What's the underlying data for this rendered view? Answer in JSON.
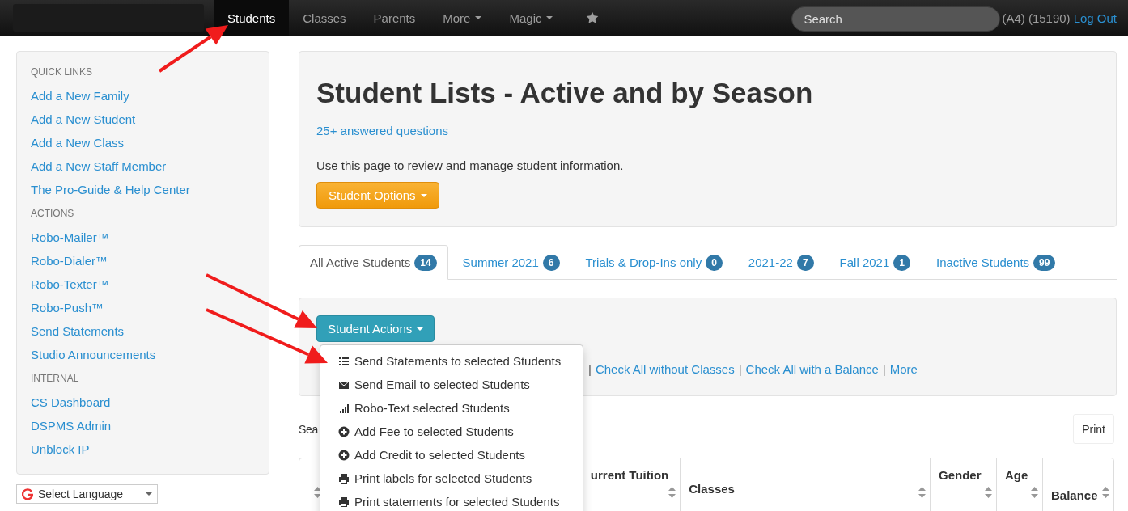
{
  "navbar": {
    "items": [
      {
        "label": "Students",
        "selected": true,
        "caret": false
      },
      {
        "label": "Classes",
        "selected": false,
        "caret": false
      },
      {
        "label": "Parents",
        "selected": false,
        "caret": false
      },
      {
        "label": "More",
        "selected": false,
        "caret": true
      },
      {
        "label": "Magic",
        "selected": false,
        "caret": true
      }
    ],
    "search": {
      "placeholder": "Search"
    },
    "account": "(A4) (15190)",
    "logout": "Log Out"
  },
  "sidebar": {
    "sections": [
      {
        "title": "QUICK LINKS",
        "links": [
          "Add a New Family",
          "Add a New Student",
          "Add a New Class",
          "Add a New Staff Member",
          "The Pro-Guide & Help Center"
        ]
      },
      {
        "title": "ACTIONS",
        "links": [
          "Robo-Mailer™",
          "Robo-Dialer™",
          "Robo-Texter™",
          "Robo-Push™",
          "Send Statements",
          "Studio Announcements"
        ]
      },
      {
        "title": "INTERNAL",
        "links": [
          "CS Dashboard",
          "DSPMS Admin",
          "Unblock IP"
        ]
      }
    ],
    "language": "Select Language"
  },
  "header": {
    "title": "Student Lists - Active and by Season",
    "help_link": "25+ answered questions",
    "description": "Use this page to review and manage student information.",
    "options_button": "Student Options"
  },
  "tabs": [
    {
      "label": "All Active Students",
      "count": "14",
      "selected": true
    },
    {
      "label": "Summer 2021",
      "count": "6",
      "selected": false
    },
    {
      "label": "Trials & Drop-Ins only",
      "count": "0",
      "selected": false
    },
    {
      "label": "2021-22",
      "count": "7",
      "selected": false
    },
    {
      "label": "Fall 2021",
      "count": "1",
      "selected": false
    },
    {
      "label": "Inactive Students",
      "count": "99",
      "selected": false
    }
  ],
  "actions": {
    "button": "Student Actions",
    "check_row": [
      {
        "kind": "sep",
        "text": "|"
      },
      {
        "kind": "link",
        "text": "Check All without Classes"
      },
      {
        "kind": "sep",
        "text": "|"
      },
      {
        "kind": "link",
        "text": "Check All with a Balance"
      },
      {
        "kind": "sep",
        "text": "|"
      },
      {
        "kind": "link",
        "text": "More"
      }
    ],
    "menu": [
      {
        "label": "Send Statements to selected Students",
        "kind": "list"
      },
      {
        "label": "Send Email to selected Students",
        "kind": "mail"
      },
      {
        "label": "Robo-Text selected Students",
        "kind": "bars"
      },
      {
        "label": "Add Fee to selected Students",
        "kind": "plus"
      },
      {
        "label": "Add Credit to selected Students",
        "kind": "plus"
      },
      {
        "label": "Print labels for selected Students",
        "kind": "print"
      },
      {
        "label": "Print statements for selected Students",
        "kind": "print"
      }
    ]
  },
  "search_label": "Sea",
  "print_button": "Print",
  "table": {
    "columns": [
      {},
      {
        "label": "urrent Tuition"
      },
      {
        "label": "Classes"
      },
      {
        "label": "Gender"
      },
      {
        "label": "Age"
      },
      {
        "label": "Balance"
      }
    ]
  }
}
